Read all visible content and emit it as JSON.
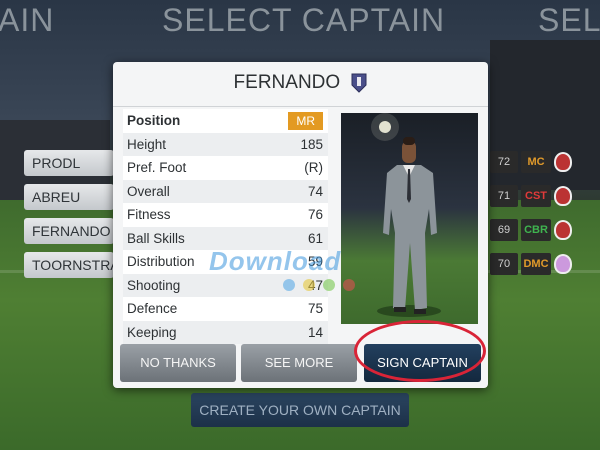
{
  "header": {
    "title": "SELECT CAPTAIN",
    "left_fragment": "AIN",
    "right_fragment": "SEL"
  },
  "left_list": [
    {
      "name": "PRODL"
    },
    {
      "name": "ABREU"
    },
    {
      "name": "FERNANDO"
    },
    {
      "name": "TOORNSTRA"
    }
  ],
  "right_list": [
    {
      "rating": "72",
      "position": "MC",
      "position_color": "#e09a2a"
    },
    {
      "rating": "71",
      "position": "CST",
      "position_color": "#e03a3a"
    },
    {
      "rating": "69",
      "position": "CBR",
      "position_color": "#3fb34f"
    },
    {
      "rating": "70",
      "position": "DMC",
      "position_color": "#e09a2a"
    }
  ],
  "dialog": {
    "player_name": "FERNANDO",
    "stats": [
      {
        "label": "Position",
        "value": "MR"
      },
      {
        "label": "Height",
        "value": "185"
      },
      {
        "label": "Pref. Foot",
        "value": "(R)"
      },
      {
        "label": "Overall",
        "value": "74"
      },
      {
        "label": "Fitness",
        "value": "76"
      },
      {
        "label": "Ball Skills",
        "value": "61"
      },
      {
        "label": "Distribution",
        "value": "59"
      },
      {
        "label": "Shooting",
        "value": "47"
      },
      {
        "label": "Defence",
        "value": "75"
      },
      {
        "label": "Keeping",
        "value": "14"
      }
    ],
    "buttons": {
      "no_thanks": "NO THANKS",
      "see_more": "SEE MORE",
      "sign_captain": "SIGN CAPTAIN"
    }
  },
  "footer": {
    "create_captain": "CREATE YOUR OWN CAPTAIN"
  },
  "watermark": "Download",
  "colors": {
    "position_badge": "#e39a22",
    "highlight_ring": "#d92437",
    "primary_button": "#1c3450"
  }
}
